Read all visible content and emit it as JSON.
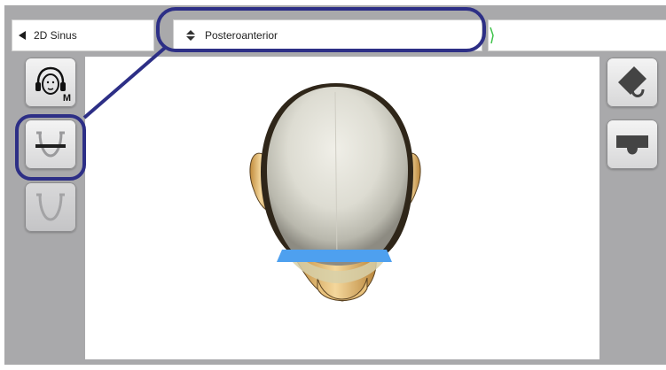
{
  "topbar": {
    "mode_label": "2D Sinus",
    "projection_label": "Posteroanterior"
  },
  "side_buttons": {
    "head_badge": "M"
  },
  "icons": {
    "mode_prev": "triangle-left-icon",
    "projection_select": "up-down-arrows-icon",
    "head": "head-headphones-icon",
    "jaw_line": "jaw-with-line-icon",
    "jaw": "jaw-icon",
    "edit": "eraser-pencil-icon",
    "bite": "bite-block-icon"
  },
  "colors": {
    "highlight": "#2d2f86",
    "panel": "#a9a9ab",
    "marker": "#4ea0ef"
  }
}
